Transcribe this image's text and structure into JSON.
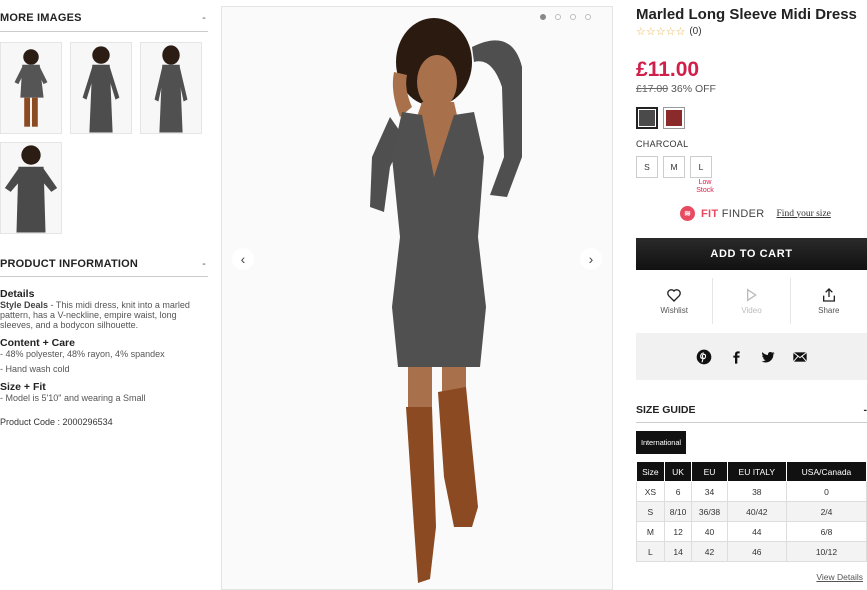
{
  "left": {
    "more_images": {
      "title": "MORE IMAGES",
      "toggle": "-"
    },
    "product_info": {
      "title": "PRODUCT INFORMATION",
      "toggle": "-",
      "details_heading": "Details",
      "style_deals_label": "Style Deals",
      "details_text": " - This midi dress, knit into a marled pattern, has a V-neckline, empire waist, long sleeves, and a bodycon silhouette.",
      "content_heading": "Content + Care",
      "content_lines": [
        "- 48% polyester, 48% rayon, 4% spandex",
        "- Hand wash cold"
      ],
      "fit_heading": "Size + Fit",
      "fit_line": "- Model is 5'10\" and wearing a Small",
      "product_code": "Product Code : 2000296534"
    }
  },
  "gallery": {
    "prev": "‹",
    "next": "›",
    "dots": 4,
    "active_dot": 0
  },
  "product": {
    "title": "Marled Long Sleeve Midi Dress",
    "stars": "☆☆☆☆☆",
    "review_count": "(0)",
    "price": "£11.00",
    "was_price": "£17.00",
    "discount": "36% OFF",
    "colors": [
      {
        "name": "charcoal",
        "hex": "#4a4a4a",
        "selected": true
      },
      {
        "name": "burgundy",
        "hex": "#8b2a2a",
        "selected": false
      }
    ],
    "selected_color": "CHARCOAL",
    "sizes": [
      "S",
      "M",
      "L"
    ],
    "low_stock": "Low Stock",
    "fit_finder_brand_a": "FIT",
    "fit_finder_brand_b": " FINDER",
    "find_size": "Find your size",
    "add_to_cart": "ADD TO CART",
    "wishlist": "Wishlist",
    "video": "Video",
    "share": "Share"
  },
  "size_guide": {
    "title": "SIZE GUIDE",
    "toggle": "-",
    "tab": "International",
    "headers": [
      "Size",
      "UK",
      "EU",
      "EU ITALY",
      "USA/Canada"
    ],
    "rows": [
      [
        "XS",
        "6",
        "34",
        "38",
        "0"
      ],
      [
        "S",
        "8/10",
        "36/38",
        "40/42",
        "2/4"
      ],
      [
        "M",
        "12",
        "40",
        "44",
        "6/8"
      ],
      [
        "L",
        "14",
        "42",
        "46",
        "10/12"
      ]
    ],
    "view_details": "View Details"
  }
}
